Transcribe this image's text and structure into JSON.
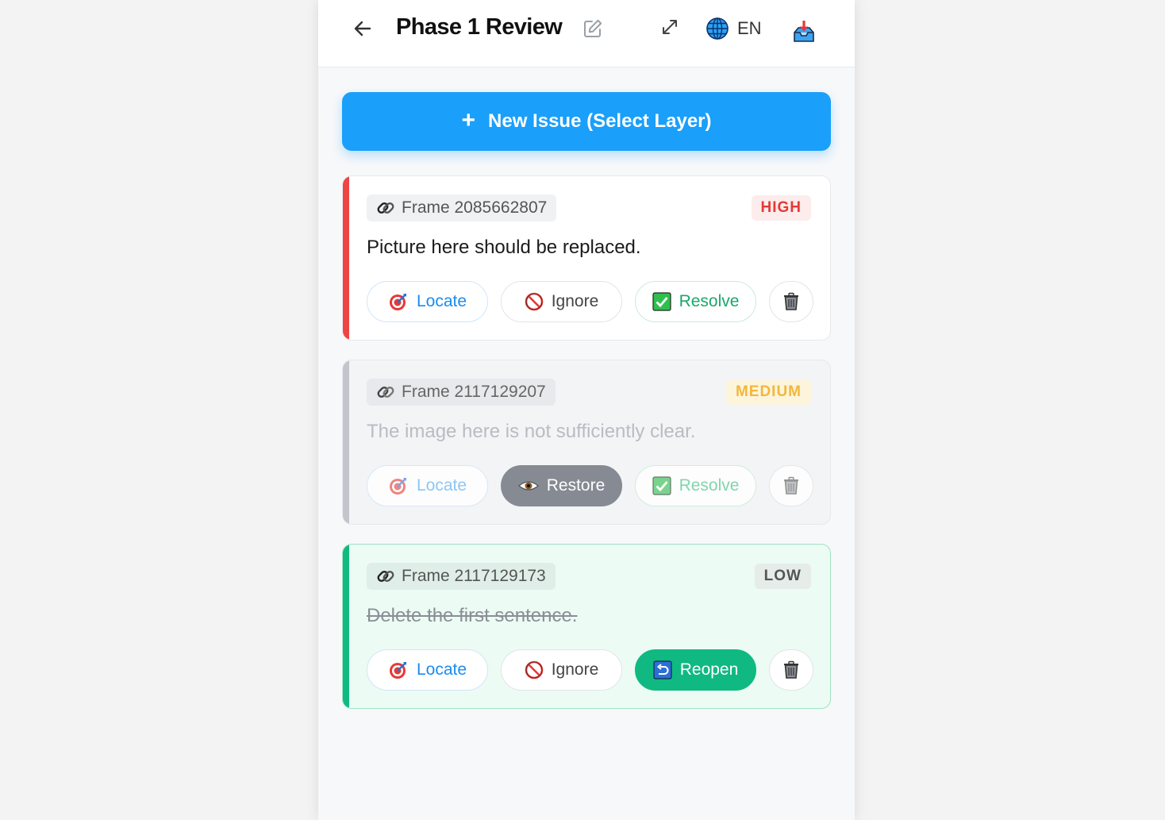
{
  "header": {
    "title": "Phase 1 Review",
    "lang": "EN"
  },
  "new_issue_label": "New Issue (Select Layer)",
  "issues": [
    {
      "frame": "Frame 2085662807",
      "severity": "HIGH",
      "description": "Picture here should be replaced.",
      "status": "open",
      "actions": {
        "locate": "Locate",
        "middle": "Ignore",
        "right": "Resolve"
      }
    },
    {
      "frame": "Frame 2117129207",
      "severity": "MEDIUM",
      "description": "The image here is not sufficiently clear.",
      "status": "ignored",
      "actions": {
        "locate": "Locate",
        "middle": "Restore",
        "right": "Resolve"
      }
    },
    {
      "frame": "Frame 2117129173",
      "severity": "LOW",
      "description": "Delete the first sentence.",
      "status": "resolved",
      "actions": {
        "locate": "Locate",
        "middle": "Ignore",
        "right": "Reopen"
      }
    }
  ],
  "colors": {
    "accent": "#1a9ffb",
    "high": "#e53935",
    "medium": "#f2b73c",
    "resolved": "#10b981"
  }
}
